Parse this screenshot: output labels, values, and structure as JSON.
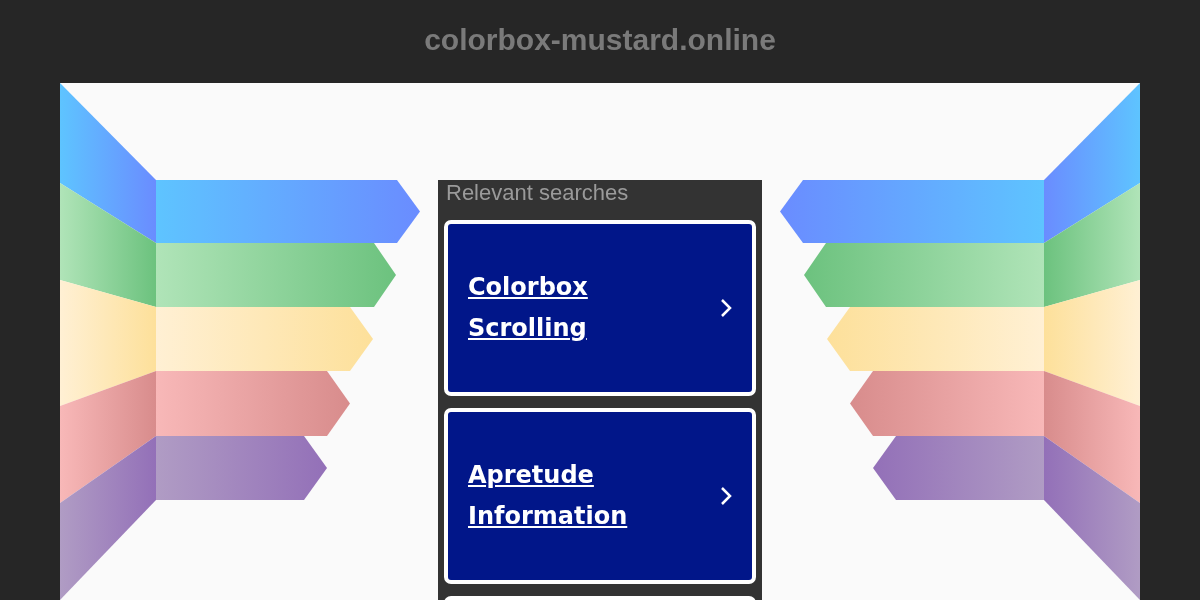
{
  "site": {
    "domain": "colorbox-mustard.online"
  },
  "searches": {
    "title": "Relevant searches",
    "links": [
      {
        "label": "Colorbox Scrolling"
      },
      {
        "label": "Apretude Information"
      }
    ],
    "more_below": true
  }
}
